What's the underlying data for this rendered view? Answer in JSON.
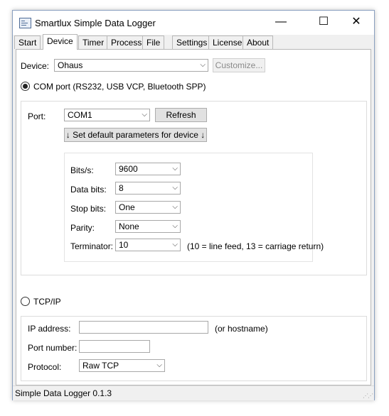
{
  "window": {
    "title": "Smartlux Simple Data Logger",
    "minimize_glyph": "—",
    "maximize_glyph": "☐",
    "close_glyph": "✕"
  },
  "tabs": [
    "Start",
    "Device",
    "Timer",
    "Process",
    "File",
    "Settings",
    "License",
    "About"
  ],
  "active_tab": "Device",
  "device": {
    "label": "Device:",
    "value": "Ohaus",
    "customize_label": "Customize..."
  },
  "com": {
    "radio_label": "COM port (RS232, USB VCP, Bluetooth SPP)",
    "port_label": "Port:",
    "port_value": "COM1",
    "refresh_label": "Refresh",
    "defaults_label": "↓ Set default parameters for device ↓",
    "bits_label": "Bits/s:",
    "bits_value": "9600",
    "databits_label": "Data bits:",
    "databits_value": "8",
    "stopbits_label": "Stop bits:",
    "stopbits_value": "One",
    "parity_label": "Parity:",
    "parity_value": "None",
    "terminator_label": "Terminator:",
    "terminator_value": "10",
    "terminator_hint": "(10 = line feed, 13 = carriage return)"
  },
  "tcp": {
    "radio_label": "TCP/IP",
    "ip_label": "IP address:",
    "ip_value": "",
    "ip_hint": "(or hostname)",
    "port_label": "Port number:",
    "port_value": "",
    "protocol_label": "Protocol:",
    "protocol_value": "Raw TCP"
  },
  "status": {
    "text": "Simple Data Logger 0.1.3"
  },
  "icons": {
    "chevron": "chevron-down-icon",
    "grip": "resize-grip-icon"
  }
}
